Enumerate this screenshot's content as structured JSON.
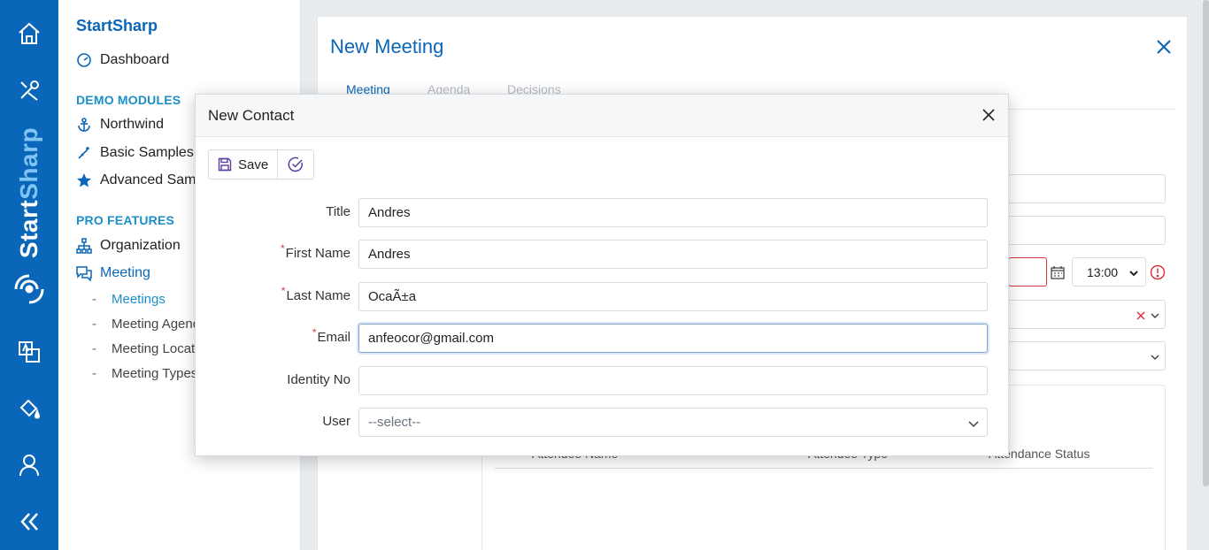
{
  "rail": {
    "brand_part1": "Start",
    "brand_part2": "Sharp",
    "icons": [
      "home-icon",
      "tools-icon",
      "translate-icon",
      "paint-bucket-icon",
      "user-icon",
      "collapse-icon"
    ]
  },
  "sidebar": {
    "brand": "StartSharp",
    "dashboard": "Dashboard",
    "section_demo": "DEMO MODULES",
    "northwind": "Northwind",
    "basic_samples": "Basic Samples",
    "advanced_samples": "Advanced Samples",
    "section_pro": "PRO FEATURES",
    "organization": "Organization",
    "meeting": "Meeting",
    "meeting_items": [
      "Meetings",
      "Meeting Agenda Types",
      "Meeting Locations",
      "Meeting Types"
    ]
  },
  "meeting_dialog": {
    "title": "New Meeting",
    "tabs": [
      "Meeting",
      "Agenda",
      "Decisions"
    ],
    "time_value": "13:00",
    "table_headers": [
      "Attendee Name",
      "Attendee Type",
      "Attendance Status"
    ]
  },
  "contact_dialog": {
    "title": "New Contact",
    "save_label": "Save",
    "fields": {
      "title_label": "Title",
      "title_value": "Andres",
      "first_name_label": "First Name",
      "first_name_value": "Andres",
      "last_name_label": "Last Name",
      "last_name_value": "OcaÃ±a",
      "email_label": "Email",
      "email_value": "anfeocor@gmail.com",
      "identity_label": "Identity No",
      "identity_value": "",
      "user_label": "User",
      "user_value": "--select--"
    }
  },
  "colors": {
    "primary": "#0a66b8",
    "accent": "#1c8fc9",
    "required": "#d9363e"
  }
}
